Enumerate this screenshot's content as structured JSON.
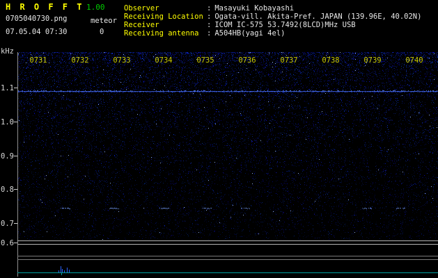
{
  "header": {
    "title": "H R O F F T",
    "version": "1.00",
    "filename": "0705040730.png",
    "mode": "meteor",
    "datetime": "07.05.04 07:30",
    "count": "0"
  },
  "station": {
    "separator": ":",
    "rows": [
      {
        "label": "Observer",
        "value": "Masayuki Kobayashi"
      },
      {
        "label": "Receiving Location",
        "value": "Ogata-vill. Akita-Pref. JAPAN (139.96E, 40.02N)"
      },
      {
        "label": "Receiver",
        "value": "ICOM IC-575 53.7492(8LCD)MHz USB"
      },
      {
        "label": "Receiving antenna",
        "value": "A504HB(yagi 4el)"
      }
    ]
  },
  "chart_data": {
    "type": "heatmap",
    "subtype": "radio-meteor-spectrogram",
    "x_ticks": [
      "0731",
      "0732",
      "0733",
      "0734",
      "0735",
      "0736",
      "0737",
      "0738",
      "0739",
      "0740"
    ],
    "y_axis_unit": "kHz",
    "y_ticks": [
      "1.1",
      "1.0",
      "0.9",
      "0.8",
      "0.7",
      "0.6"
    ],
    "features": {
      "carrier_line_khz": 1.09,
      "weak_echo_trace_khz": 0.745,
      "weak_echo_positions_min": [
        1.03,
        2.2,
        3.4,
        4.42,
        5.35,
        8.25,
        9.05
      ],
      "level_spikes": [
        {
          "min": 0.99,
          "amp": 0.35
        },
        {
          "min": 1.03,
          "amp": 0.95
        },
        {
          "min": 1.07,
          "amp": 0.55
        },
        {
          "min": 1.12,
          "amp": 0.3
        },
        {
          "min": 1.18,
          "amp": 0.75
        },
        {
          "min": 1.24,
          "amp": 0.4
        }
      ],
      "noise_floor": "blue speckle noise, densest toward top of band"
    },
    "colors": {
      "noise": "#1133cc",
      "carrier": "#466eff",
      "time_labels": "#c9c900",
      "freq_labels": "#d9d9d9",
      "level_trace": "#00a0a0",
      "header_accent": "#ffff00",
      "version_green": "#00cc00"
    }
  }
}
